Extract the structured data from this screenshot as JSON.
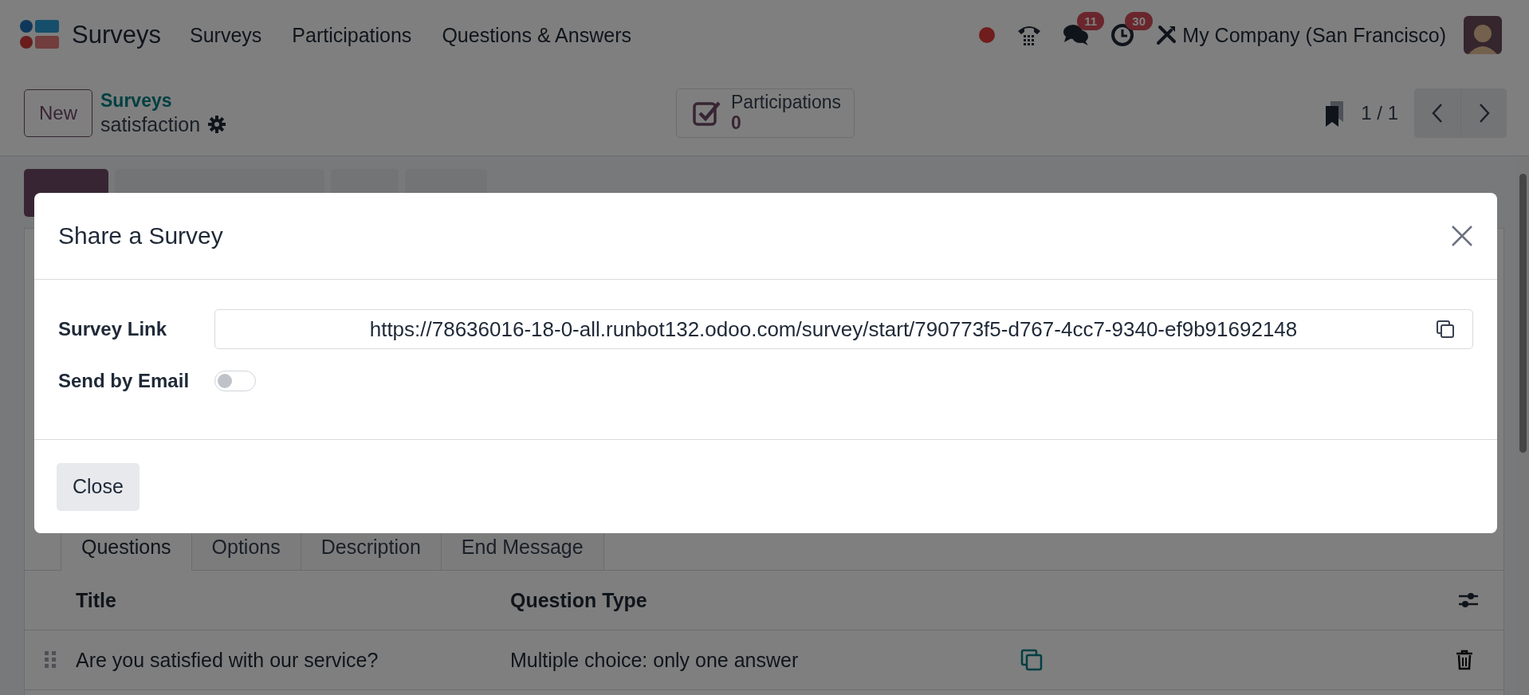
{
  "navbar": {
    "app_name": "Surveys",
    "menu": [
      {
        "label": "Surveys"
      },
      {
        "label": "Participations"
      },
      {
        "label": "Questions & Answers"
      }
    ],
    "systray": [
      {
        "kind": "record-dot"
      },
      {
        "kind": "phone"
      },
      {
        "kind": "chat",
        "badge": "11"
      },
      {
        "kind": "clock",
        "badge": "30"
      },
      {
        "kind": "tools"
      }
    ],
    "company": "My Company (San Francisco)"
  },
  "control_panel": {
    "new_button": "New",
    "breadcrumb": "Surveys",
    "record_name": "satisfaction",
    "smart_button": {
      "label": "Participations",
      "count": "0"
    },
    "pager": "1 / 1"
  },
  "status_buttons": [
    {
      "primary": true
    },
    {
      "primary": false
    },
    {
      "primary": false
    },
    {
      "primary": false
    }
  ],
  "tabs": [
    {
      "label": "Questions",
      "selected": true
    },
    {
      "label": "Options",
      "selected": false
    },
    {
      "label": "Description",
      "selected": false
    },
    {
      "label": "End Message",
      "selected": false
    }
  ],
  "table": {
    "columns": [
      "Title",
      "Question Type"
    ],
    "rows": [
      {
        "title": "Are you satisfied with our service?",
        "question_type": "Multiple choice: only one answer"
      }
    ]
  },
  "dialog": {
    "title": "Share a Survey",
    "fields": [
      {
        "kind": "link",
        "label": "Survey Link",
        "value": "https://78636016-18-0-all.runbot132.odoo.com/survey/start/790773f5-d767-4cc7-9340-ef9b91692148"
      },
      {
        "kind": "toggle",
        "label": "Send by Email",
        "on": false
      }
    ],
    "buttons": [
      "Close"
    ]
  }
}
